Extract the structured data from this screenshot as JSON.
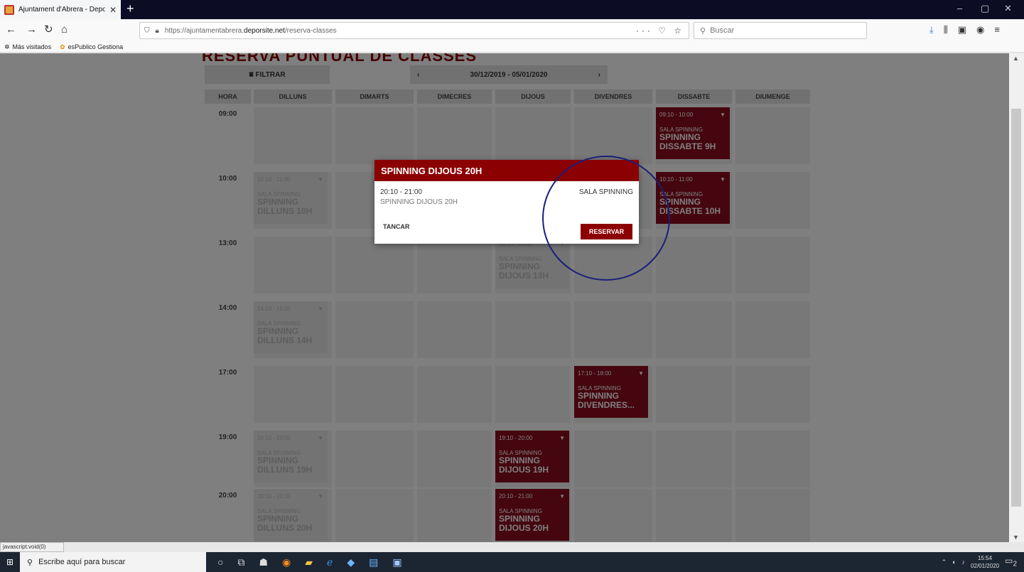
{
  "browser": {
    "tab_title": "Ajuntament d'Abrera - DeporSite",
    "tab_close": "✕",
    "new_tab": "+",
    "window_controls": [
      "–",
      "▢",
      "✕"
    ],
    "back": "←",
    "forward": "→",
    "reload": "↻",
    "home": "⌂",
    "url_prefix": "https://ajuntamentabrera.",
    "url_domain": "deporsite.net",
    "url_path": "/reserva-classes",
    "url_actions": "··· ♡ ☆",
    "search_placeholder": "Buscar",
    "toolbar_icons": [
      "⤓",
      "⫼",
      "▣",
      "◉",
      "≡"
    ],
    "bookmarks": [
      "Más visitados",
      "esPublico Gestiona"
    ],
    "status_text": "javascript:void(0)"
  },
  "page": {
    "title": "RESERVA PUNTUAL DE CLASSES",
    "filter_label": "FILTRAR",
    "date_prev": "‹",
    "date_range": "30/12/2019 - 05/01/2020",
    "date_next": "›",
    "columns": [
      "HORA",
      "DILLUNS",
      "DIMARTS",
      "DIMECRES",
      "DIJOUS",
      "DIVENDRES",
      "DISSABTE",
      "DIUMENGE"
    ],
    "hours": [
      "09:00",
      "10:00",
      "13:00",
      "14:00",
      "17:00",
      "19:00",
      "20:00"
    ],
    "events": [
      {
        "time": "09:10 - 10:00",
        "room": "SALA SPINNING",
        "name": "SPINNING DISSABTE 9H",
        "day": "DISSABTE",
        "hour": "09:00",
        "state": "active"
      },
      {
        "time": "10:10 - 11:00",
        "room": "SALA SPINNING",
        "name": "SPINNING DILLUNS 10H",
        "day": "DILLUNS",
        "hour": "10:00",
        "state": "past"
      },
      {
        "time": "10:10 - 11:00",
        "room": "SALA SPINNING",
        "name": "SPINNING DISSABTE 10H",
        "day": "DISSABTE",
        "hour": "10:00",
        "state": "active"
      },
      {
        "time": "13:10 - 14:00",
        "room": "SALA SPINNING",
        "name": "SPINNING DIJOUS 13H",
        "day": "DIJOUS",
        "hour": "13:00",
        "state": "past"
      },
      {
        "time": "14:10 - 15:00",
        "room": "SALA SPINNING",
        "name": "SPINNING DILLUNS 14H",
        "day": "DILLUNS",
        "hour": "14:00",
        "state": "past"
      },
      {
        "time": "17:10 - 18:00",
        "room": "SALA SPINNING",
        "name": "SPINNING DIVENDRES...",
        "day": "DIVENDRES",
        "hour": "17:00",
        "state": "active"
      },
      {
        "time": "19:10 - 20:00",
        "room": "SALA SPINNING",
        "name": "SPINNING DILLUNS 19H",
        "day": "DILLUNS",
        "hour": "19:00",
        "state": "past"
      },
      {
        "time": "19:10 - 20:00",
        "room": "SALA SPINNING",
        "name": "SPINNING DIJOUS 19H",
        "day": "DIJOUS",
        "hour": "19:00",
        "state": "active"
      },
      {
        "time": "20:10 - 21:00",
        "room": "SALA SPINNING",
        "name": "SPINNING DILLUNS 20H",
        "day": "DILLUNS",
        "hour": "20:00",
        "state": "past"
      },
      {
        "time": "20:10 - 21:00",
        "room": "SALA SPINNING",
        "name": "SPINNING DIJOUS 20H",
        "day": "DIJOUS",
        "hour": "20:00",
        "state": "active"
      }
    ]
  },
  "modal": {
    "title": "SPINNING DIJOUS 20H",
    "time": "20:10 - 21:00",
    "name": "SPINNING DIJOUS 20H",
    "room": "SALA SPINNING",
    "close_label": "TANCAR",
    "reserve_label": "RESERVAR"
  },
  "taskbar": {
    "search_placeholder": "Escribe aquí para buscar",
    "time": "15:54",
    "date": "02/01/2020",
    "notification_count": "2"
  },
  "colors": {
    "accent": "#8b0000",
    "event_active": "#8b0d1e",
    "annotation_circle": "#1a1f7a"
  }
}
